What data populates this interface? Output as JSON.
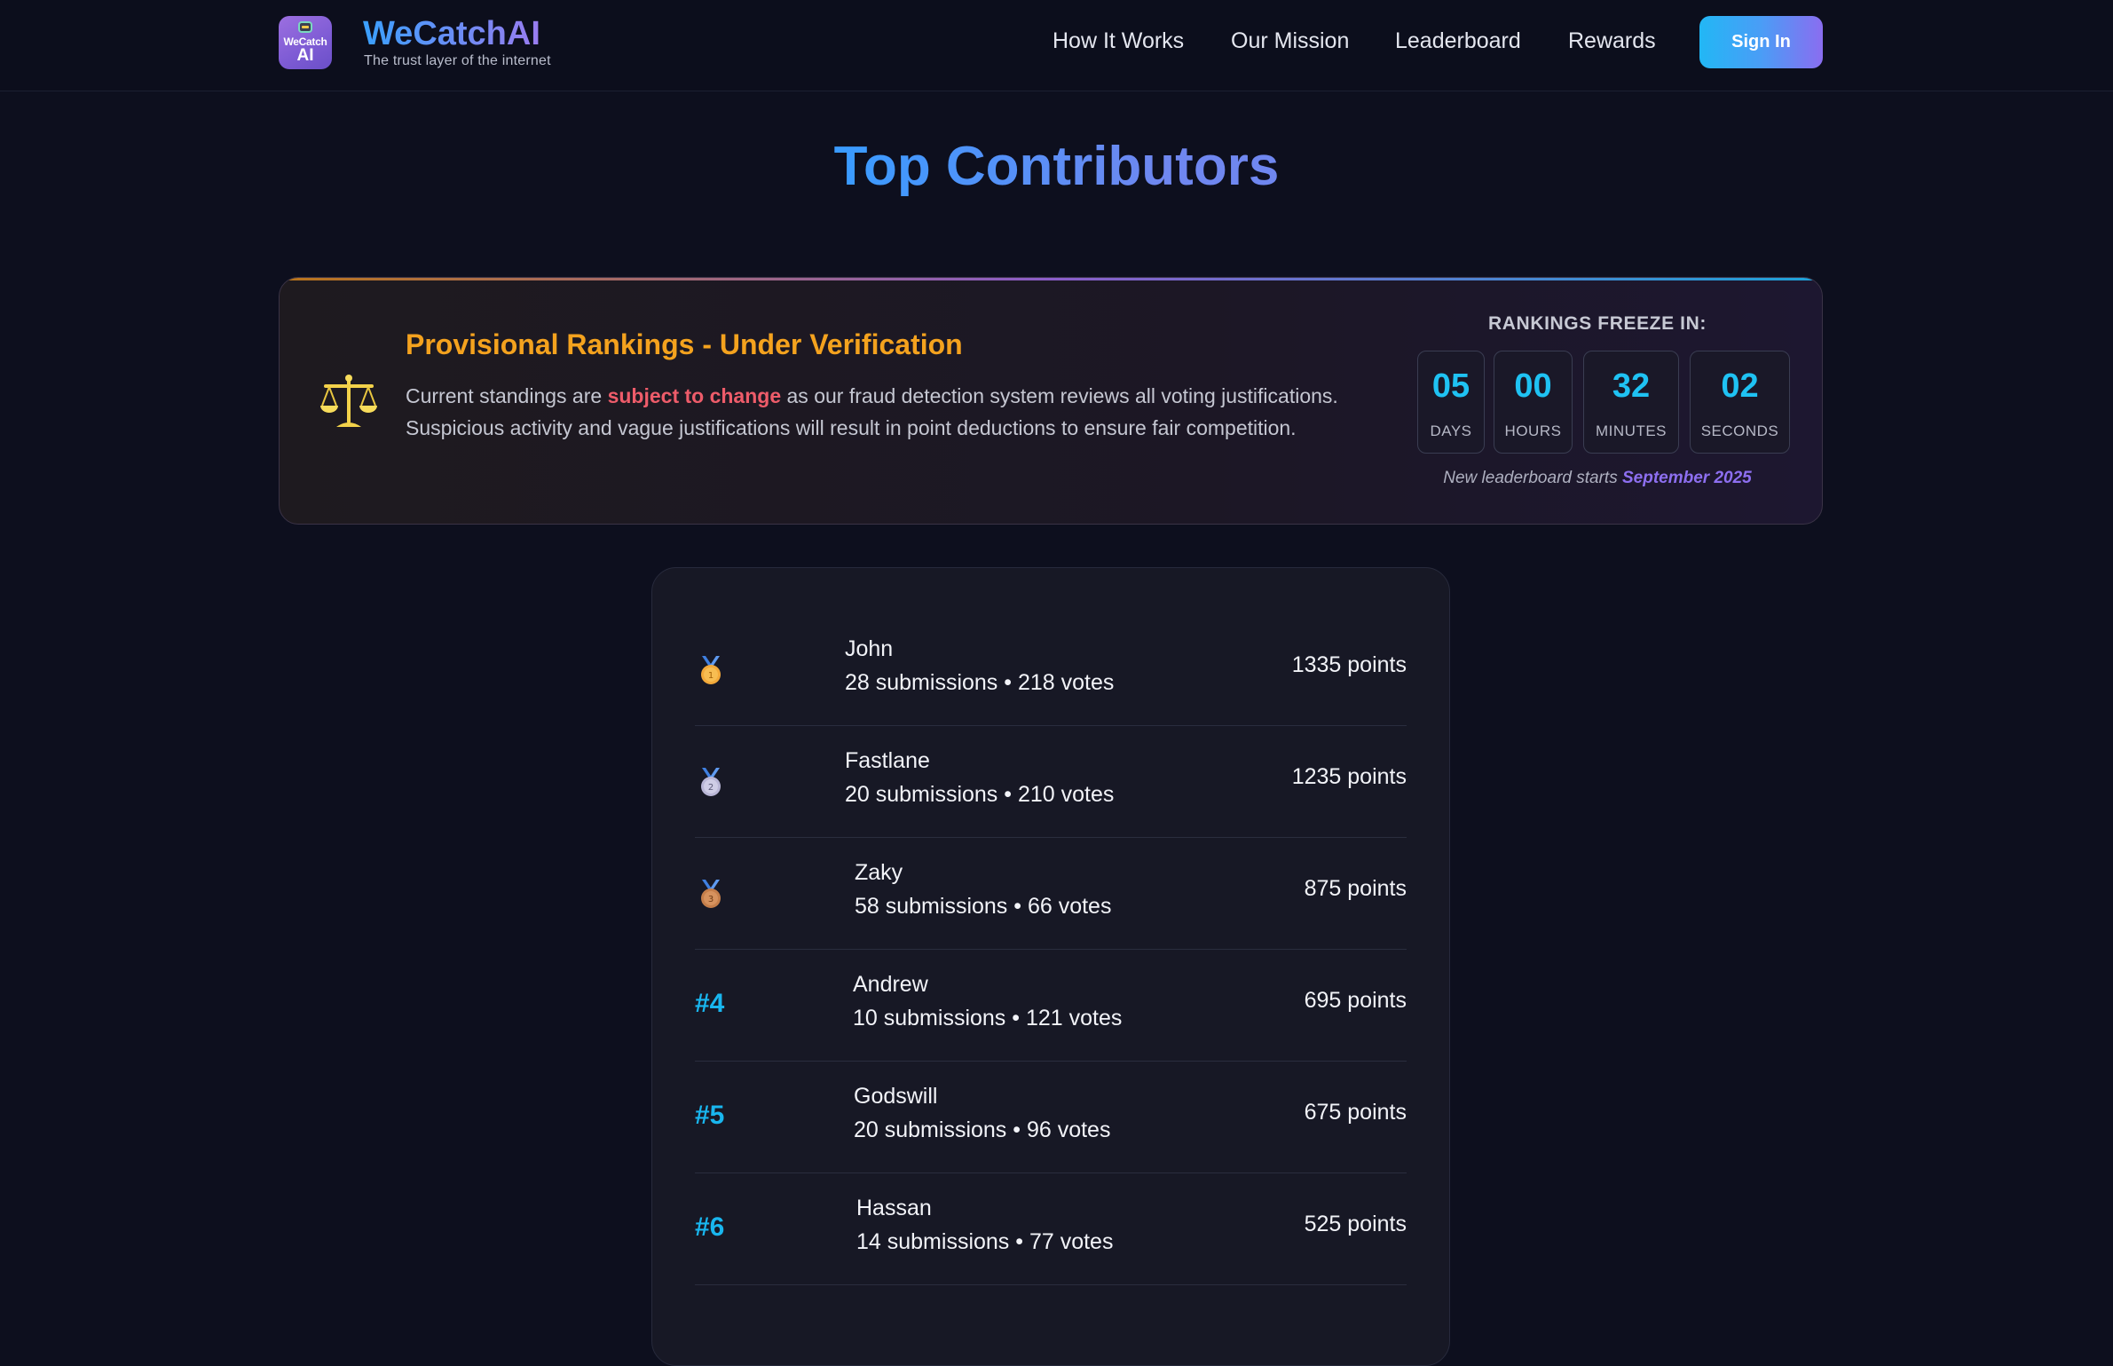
{
  "header": {
    "logo_line1": "WeCatch",
    "logo_line2": "AI",
    "brand_name": "WeCatchAI",
    "tagline": "The trust layer of the internet",
    "nav": [
      "How It Works",
      "Our Mission",
      "Leaderboard",
      "Rewards"
    ],
    "sign_in_label": "Sign In"
  },
  "page_title": "Top Contributors",
  "notice": {
    "icon": "scales-icon",
    "title": "Provisional Rankings - Under Verification",
    "text_before": "Current standings are ",
    "text_highlight": "subject to change",
    "text_after": " as our fraud detection system reviews all voting justifications. Suspicious activity and vague justifications will result in point deductions to ensure fair competition.",
    "freeze_label": "RANKINGS FREEZE IN:",
    "countdown": [
      {
        "value": "05",
        "unit": "DAYS"
      },
      {
        "value": "00",
        "unit": "HOURS"
      },
      {
        "value": "32",
        "unit": "MINUTES"
      },
      {
        "value": "02",
        "unit": "SECONDS"
      }
    ],
    "new_leaderboard_prefix": "New leaderboard starts ",
    "new_leaderboard_date": "September 2025"
  },
  "leaderboard": [
    {
      "rank_display": "",
      "medal": "gold-medal-icon",
      "name": "John",
      "stats": "28 submissions • 218 votes",
      "points": "1335 points"
    },
    {
      "rank_display": "",
      "medal": "silver-medal-icon",
      "name": "Fastlane",
      "stats": "20 submissions • 210 votes",
      "points": "1235 points"
    },
    {
      "rank_display": "",
      "medal": "bronze-medal-icon",
      "name": "Zaky",
      "stats": "58 submissions • 66 votes",
      "points": "875 points"
    },
    {
      "rank_display": "#4",
      "medal": "",
      "name": "Andrew",
      "stats": "10 submissions • 121 votes",
      "points": "695 points"
    },
    {
      "rank_display": "#5",
      "medal": "",
      "name": "Godswill",
      "stats": "20 submissions • 96 votes",
      "points": "675 points"
    },
    {
      "rank_display": "#6",
      "medal": "",
      "name": "Hassan",
      "stats": "14 submissions • 77 votes",
      "points": "525 points"
    }
  ],
  "colors": {
    "background": "#0d0f1e",
    "accent_blue": "#1fc2f3",
    "warning_orange": "#f4a21e",
    "warning_red": "#ee5c6a",
    "accent_purple": "#8d6ff0"
  }
}
